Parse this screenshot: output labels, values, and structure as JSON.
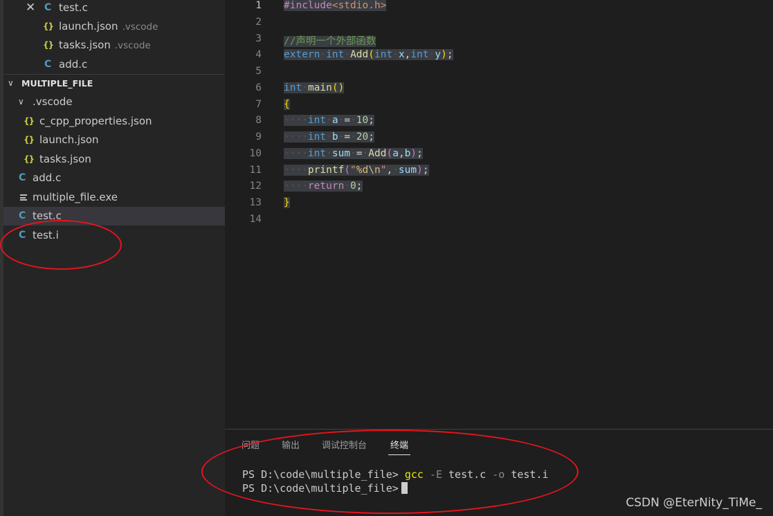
{
  "explorer": {
    "open_editors": [
      {
        "name": "test.c",
        "hint": "",
        "type": "c",
        "active": true
      },
      {
        "name": "launch.json",
        "hint": ".vscode",
        "type": "json"
      },
      {
        "name": "tasks.json",
        "hint": ".vscode",
        "type": "json"
      },
      {
        "name": "add.c",
        "hint": "",
        "type": "c"
      }
    ],
    "folder_name": "MULTIPLE_FILE",
    "subfolder": ".vscode",
    "subfolder_files": [
      "c_cpp_properties.json",
      "launch.json",
      "tasks.json"
    ],
    "files": [
      "add.c",
      "multiple_file.exe",
      "test.c",
      "test.i"
    ],
    "selected_file": "test.c"
  },
  "editor": {
    "line_numbers": [
      "1",
      "2",
      "3",
      "4",
      "5",
      "6",
      "7",
      "8",
      "9",
      "10",
      "11",
      "12",
      "13",
      "14"
    ],
    "current_line": "1",
    "code": {
      "l1_directive": "#include",
      "l1_header": "<stdio.h>",
      "l3_comment": "//声明一个外部函数",
      "l4": [
        "extern",
        "int",
        "Add",
        "(",
        "int",
        "x",
        ",",
        "int",
        "y",
        ")",
        ";"
      ],
      "l6": [
        "int",
        "main",
        "(",
        ")"
      ],
      "l7": "{",
      "l8": [
        "int",
        "a",
        "=",
        "10",
        ";"
      ],
      "l9": [
        "int",
        "b",
        "=",
        "20",
        ";"
      ],
      "l10": [
        "int",
        "sum",
        "=",
        "Add",
        "(",
        "a",
        ",",
        "b",
        ")",
        ";"
      ],
      "l11": [
        "printf",
        "(",
        "\"",
        "%d",
        "\\n",
        "\"",
        ",",
        "sum",
        ")",
        ";"
      ],
      "l12": [
        "return",
        "0",
        ";"
      ],
      "l13": "}"
    }
  },
  "panel": {
    "tabs": [
      "问题",
      "输出",
      "调试控制台",
      "终端"
    ],
    "active_tab": "终端",
    "terminal": {
      "prompt": "PS D:\\code\\multiple_file>",
      "line1_cmd": "gcc",
      "line1_flag1": "-E",
      "line1_arg1": "test.c",
      "line1_flag2": "-o",
      "line1_arg2": "test.i"
    }
  },
  "watermark": "CSDN @EterNity_TiMe_",
  "colors": {
    "annotation": "#e8141c",
    "c_icon": "#519aba",
    "json_icon": "#cbcb41"
  }
}
